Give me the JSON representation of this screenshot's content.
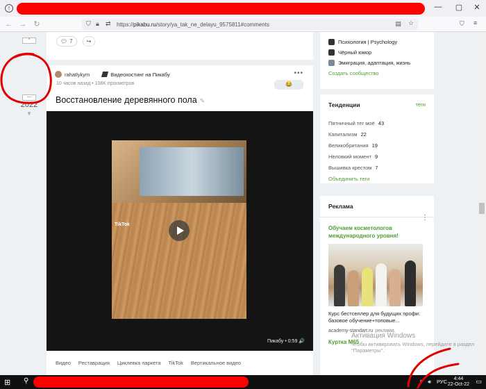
{
  "browser": {
    "url_prefix": "https://",
    "url_host": "pikabu.ru",
    "url_path": "/story/ya_tak_ne_delayu_9575811#comments",
    "win_min": "—",
    "win_max": "▢",
    "win_close": "✕"
  },
  "gutter": {
    "vote_up": "▲",
    "vote_count": "2022",
    "vote_down": "▼"
  },
  "post_actions": {
    "comments_count": "7"
  },
  "post": {
    "author": "rahatlykym",
    "community": "Видеохостинг на Пикабу",
    "meta": "10 часов назад • 108K просмотров",
    "title": "Восстановление деревянного пола",
    "emoji": "😂",
    "video_watermark": "TikTok",
    "video_badge": "Пикабу • 0:59 🔊",
    "tags": [
      "Видео",
      "Реставрация",
      "Циклевка паркета",
      "TikTok",
      "Вертикальное видео"
    ]
  },
  "sidebar": {
    "communities": [
      {
        "name": "Психология | Psychology"
      },
      {
        "name": "Чёрный юмор"
      },
      {
        "name": "Эмиграция, адаптация, жизнь"
      }
    ],
    "create_community": "Создать сообщество",
    "trends_title": "Тенденции",
    "trends_link": "теги",
    "trends": [
      {
        "name": "Пятничный тег моё",
        "count": "43"
      },
      {
        "name": "Капитализм",
        "count": "22"
      },
      {
        "name": "Великобритания",
        "count": "19"
      },
      {
        "name": "Неловкий момент",
        "count": "9"
      },
      {
        "name": "Вышивка крестом",
        "count": "7"
      }
    ],
    "merge_tags": "Объединить теги",
    "ad_title": "Реклама",
    "ad_headline": "Обучаем косметологов международного уровня!",
    "ad_text": "Курс бестселлер для будущих профи: базовое обучение+топовые...",
    "ad_source": "academy-standart.ru",
    "ad_source_label": "реклама",
    "ad_next": "Куртка M65"
  },
  "watermark": {
    "line1": "Активация Windows",
    "line2": "Чтобы активировать Windows, перейдите в раздел \"Параметры\"."
  },
  "taskbar": {
    "lang": "РУС",
    "time": "4:44",
    "date": "22-Oct-22"
  },
  "colors": {
    "accent_green": "#4f9d32",
    "annotation_red": "#e00000"
  }
}
